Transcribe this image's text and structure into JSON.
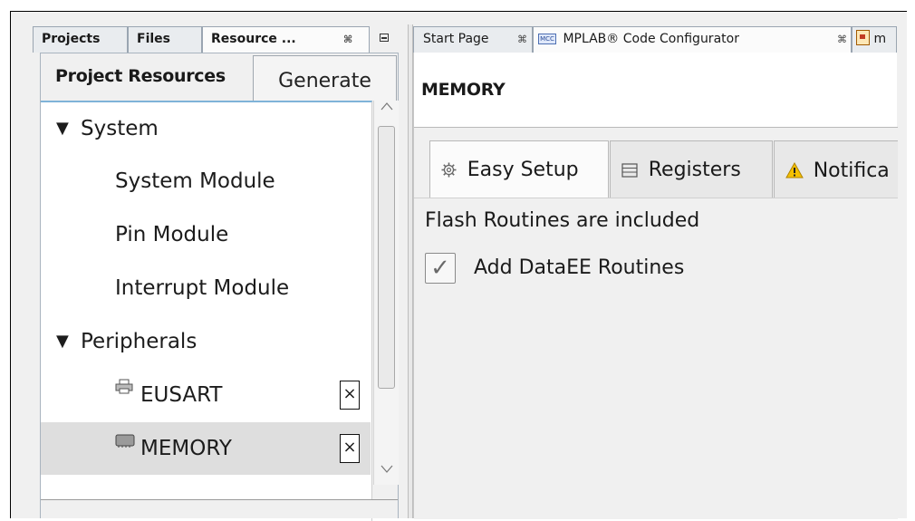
{
  "left_panel": {
    "tabs": [
      {
        "label": "Projects"
      },
      {
        "label": "Files"
      },
      {
        "label": "Resource ..."
      }
    ],
    "close_glyph": "⌘",
    "minimize_icon": "minimize-icon",
    "header": {
      "title": "Project Resources",
      "generate_label": "Generate"
    },
    "tree": {
      "system": "System",
      "system_module": "System Module",
      "pin_module": "Pin Module",
      "interrupt_module": "Interrupt Module",
      "peripherals": "Peripherals",
      "eusart": "EUSART",
      "memory": "MEMORY",
      "remove_glyph": "×",
      "expanded_glyph": "▼"
    }
  },
  "right_panel": {
    "tabs": [
      {
        "label": "Start Page"
      },
      {
        "label": "MPLAB® Code Configurator",
        "icon_text": "MCC"
      },
      {
        "label": "m"
      }
    ],
    "close_glyph": "⌘",
    "content_title": "MEMORY",
    "sub_tabs": [
      {
        "label": "Easy Setup",
        "icon": "gear-icon"
      },
      {
        "label": "Registers",
        "icon": "list-icon"
      },
      {
        "label": "Notifica",
        "icon": "warning-icon"
      }
    ],
    "flash_text": "Flash Routines are included",
    "checkbox": {
      "label": "Add DataEE Routines",
      "checked": true,
      "check_glyph": "✓"
    }
  },
  "colors": {
    "tree_selection": "#dedede",
    "tree_focus_border": "#7fb3d8",
    "warning_icon": "#f0b400"
  }
}
